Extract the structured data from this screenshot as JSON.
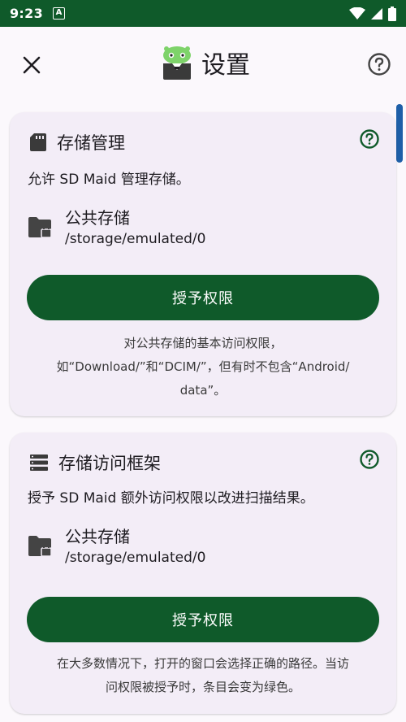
{
  "status_bar": {
    "time": "9:23",
    "notification_icon": "a-box-icon",
    "icons": [
      "wifi-icon",
      "signal-icon",
      "battery-icon"
    ],
    "color": "#0f5a2a"
  },
  "app_bar": {
    "title": "设置",
    "close_icon": "close-icon",
    "help_icon": "help-circle-icon",
    "logo_icon": "sd-maid-logo"
  },
  "cards": [
    {
      "icon": "sd-card-icon",
      "title": "存储管理",
      "description": "允许 SD Maid 管理存储。",
      "storage_name": "公共存储",
      "storage_path": "/storage/emulated/0",
      "button_label": "授予权限",
      "note_lines": [
        "对公共存储的基本访问权限，",
        "如“Download/”和“DCIM/”，但有时不包含“Android/",
        "data”。"
      ]
    },
    {
      "icon": "storage-list-icon",
      "title": "存储访问框架",
      "description": "授予 SD Maid 额外访问权限以改进扫描结果。",
      "storage_name": "公共存储",
      "storage_path": "/storage/emulated/0",
      "button_label": "授予权限",
      "note_lines": [
        "在大多数情况下，打开的窗口会选择正确的路径。当访",
        "问权限被授予时，条目会变为绿色。"
      ]
    }
  ],
  "colors": {
    "accent_green": "#0f5a2a",
    "card_background": "#f3edf7",
    "page_background": "#fbf8fc",
    "scrollbar": "#1e5fa8"
  }
}
